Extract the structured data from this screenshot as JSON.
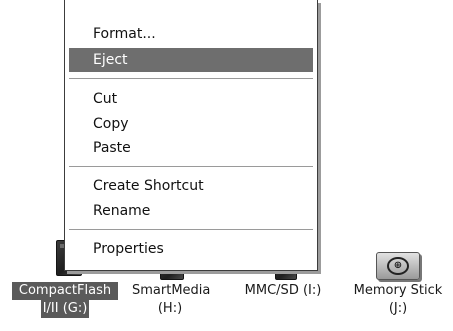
{
  "context_menu": {
    "items": [
      {
        "label": "Format..."
      },
      {
        "label": "Eject",
        "highlighted": true
      },
      {
        "label": "Cut"
      },
      {
        "label": "Copy"
      },
      {
        "label": "Paste"
      },
      {
        "label": "Create Shortcut"
      },
      {
        "label": "Rename"
      },
      {
        "label": "Properties"
      }
    ]
  },
  "drives": [
    {
      "line1": "CompactFlash",
      "line2": "I/II (G:)",
      "icon": "compactflash-icon",
      "selected": true
    },
    {
      "line1": "SmartMedia",
      "line2": "(H:)",
      "icon": "smartmedia-icon",
      "selected": false
    },
    {
      "line1": "MMC/SD (I:)",
      "line2": "",
      "icon": "mmc-sd-icon",
      "selected": false
    },
    {
      "line1": "Memory Stick",
      "line2": "(J:)",
      "icon": "memory-stick-icon",
      "selected": false
    }
  ]
}
